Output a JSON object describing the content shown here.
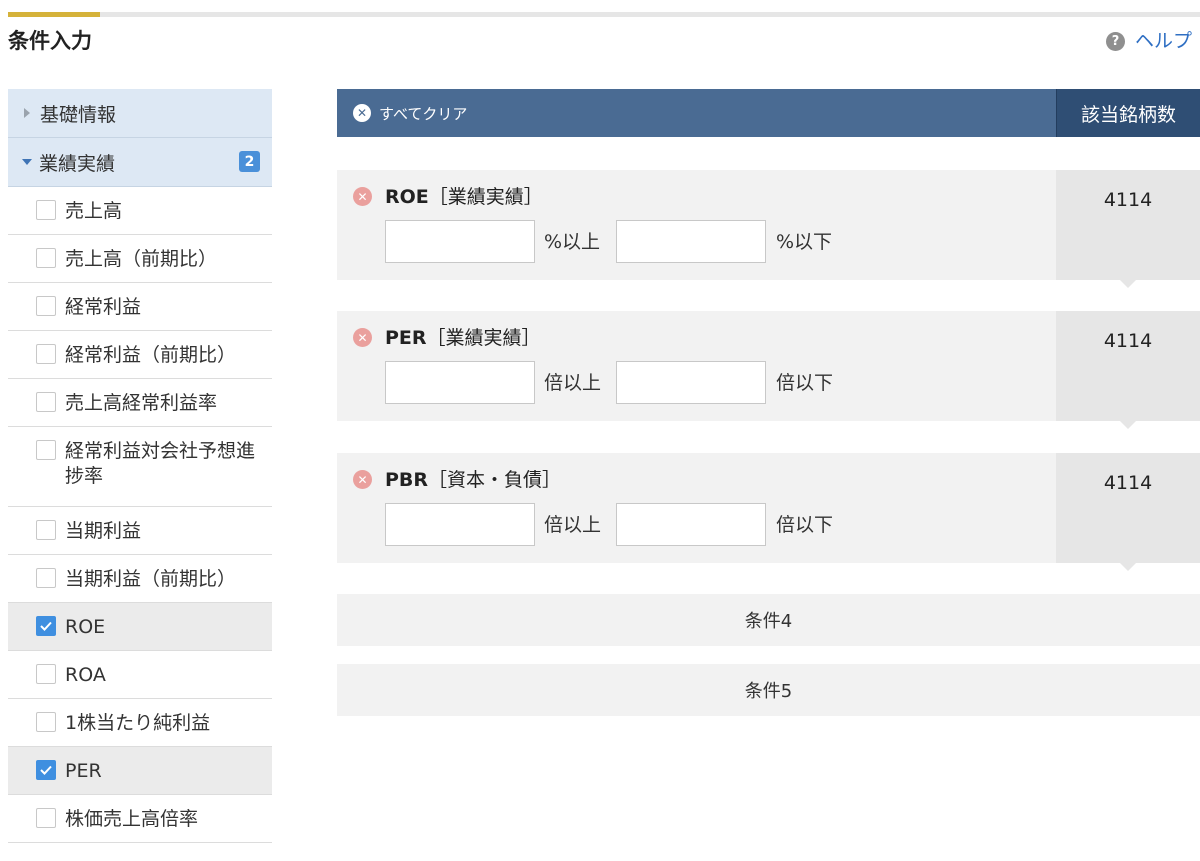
{
  "page": {
    "title": "条件入力",
    "help_label": "ヘルプ",
    "help_icon_glyph": "?",
    "accent_color": "#d5b23a"
  },
  "sidebar": {
    "categories": [
      {
        "label": "基礎情報",
        "expanded": false
      },
      {
        "label": "業績実績",
        "expanded": true,
        "badge": "2"
      }
    ],
    "items": [
      {
        "label": "売上高",
        "checked": false
      },
      {
        "label": "売上高（前期比）",
        "checked": false
      },
      {
        "label": "経常利益",
        "checked": false
      },
      {
        "label": "経常利益（前期比）",
        "checked": false
      },
      {
        "label": "売上高経常利益率",
        "checked": false
      },
      {
        "label": "経常利益対会社予想進捗率",
        "checked": false
      },
      {
        "label": "当期利益",
        "checked": false
      },
      {
        "label": "当期利益（前期比）",
        "checked": false
      },
      {
        "label": "ROE",
        "checked": true
      },
      {
        "label": "ROA",
        "checked": false
      },
      {
        "label": "1株当たり純利益",
        "checked": false
      },
      {
        "label": "PER",
        "checked": true
      },
      {
        "label": "株価売上高倍率",
        "checked": false
      }
    ]
  },
  "main": {
    "clear_all_label": "すべてクリア",
    "count_header": "該当銘柄数",
    "conditions": [
      {
        "name": "ROE",
        "category": "［業績実績］",
        "min_unit": "%以上",
        "max_unit": "%以下",
        "min_value": "",
        "max_value": "",
        "count": "4114"
      },
      {
        "name": "PER",
        "category": "［業績実績］",
        "min_unit": "倍以上",
        "max_unit": "倍以下",
        "min_value": "",
        "max_value": "",
        "count": "4114"
      },
      {
        "name": "PBR",
        "category": "［資本・負債］",
        "min_unit": "倍以上",
        "max_unit": "倍以下",
        "min_value": "",
        "max_value": "",
        "count": "4114"
      }
    ],
    "empty_slots": [
      {
        "label": "条件4"
      },
      {
        "label": "条件5"
      }
    ]
  }
}
